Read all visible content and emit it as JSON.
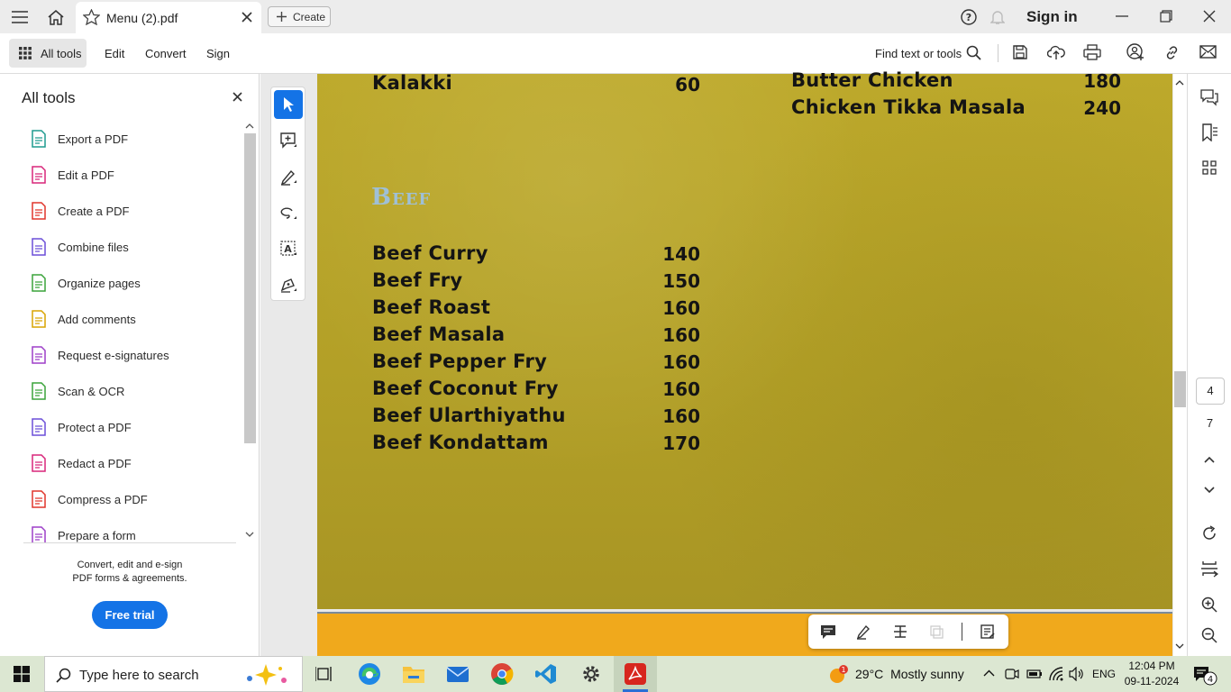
{
  "window": {
    "tab_title": "Menu (2).pdf",
    "create_label": "Create",
    "sign_in": "Sign in"
  },
  "toolbar": {
    "all_tools": "All tools",
    "menu": [
      "Edit",
      "Convert",
      "Sign"
    ],
    "find_text": "Find text or tools"
  },
  "left_panel": {
    "title": "All tools",
    "tools": [
      {
        "label": "Export a PDF",
        "icon": "export-pdf-icon",
        "color": "#1f9b8f"
      },
      {
        "label": "Edit a PDF",
        "icon": "edit-pdf-icon",
        "color": "#d8267a"
      },
      {
        "label": "Create a PDF",
        "icon": "create-pdf-icon",
        "color": "#e0352b"
      },
      {
        "label": "Combine files",
        "icon": "combine-files-icon",
        "color": "#6b4fd8"
      },
      {
        "label": "Organize pages",
        "icon": "organize-pages-icon",
        "color": "#3aa33a"
      },
      {
        "label": "Add comments",
        "icon": "add-comments-icon",
        "color": "#d9a400"
      },
      {
        "label": "Request e-signatures",
        "icon": "e-signature-icon",
        "color": "#9d3fc8"
      },
      {
        "label": "Scan & OCR",
        "icon": "scan-ocr-icon",
        "color": "#3aa33a"
      },
      {
        "label": "Protect a PDF",
        "icon": "protect-pdf-icon",
        "color": "#6b4fd8"
      },
      {
        "label": "Redact a PDF",
        "icon": "redact-pdf-icon",
        "color": "#d8267a"
      },
      {
        "label": "Compress a PDF",
        "icon": "compress-pdf-icon",
        "color": "#e0352b"
      },
      {
        "label": "Prepare a form",
        "icon": "prepare-form-icon",
        "color": "#9d3fc8"
      }
    ],
    "promo_line1": "Convert, edit and e-sign",
    "promo_line2": "PDF forms & agreements.",
    "free_trial": "Free trial"
  },
  "document": {
    "top_left_item": {
      "name": "Kalakki",
      "price": "60"
    },
    "top_right_items": [
      {
        "name": "Butter Chicken",
        "price": "180"
      },
      {
        "name": "Chicken Tikka Masala",
        "price": "240"
      }
    ],
    "section_heading": "Beef",
    "beef_items": [
      {
        "name": "Beef Curry",
        "price": "140"
      },
      {
        "name": "Beef Fry",
        "price": "150"
      },
      {
        "name": "Beef Roast",
        "price": "160"
      },
      {
        "name": "Beef Masala",
        "price": "160"
      },
      {
        "name": "Beef Pepper Fry",
        "price": "160"
      },
      {
        "name": "Beef Coconut Fry",
        "price": "160"
      },
      {
        "name": "Beef Ularthiyathu",
        "price": "160"
      },
      {
        "name": "Beef Kondattam",
        "price": "170"
      }
    ]
  },
  "navigation": {
    "current_page": "4",
    "total_pages": "7"
  },
  "taskbar": {
    "search_placeholder": "Type here to search",
    "weather_temp": "29°C",
    "weather_desc": "Mostly sunny",
    "weather_badge": "1",
    "language": "ENG",
    "time": "12:04 PM",
    "date": "09-11-2024",
    "notification_count": "4"
  },
  "colors": {
    "accent": "#1473e6",
    "page_bg": "#b7a52a",
    "section_heading": "#9fc0d6"
  }
}
